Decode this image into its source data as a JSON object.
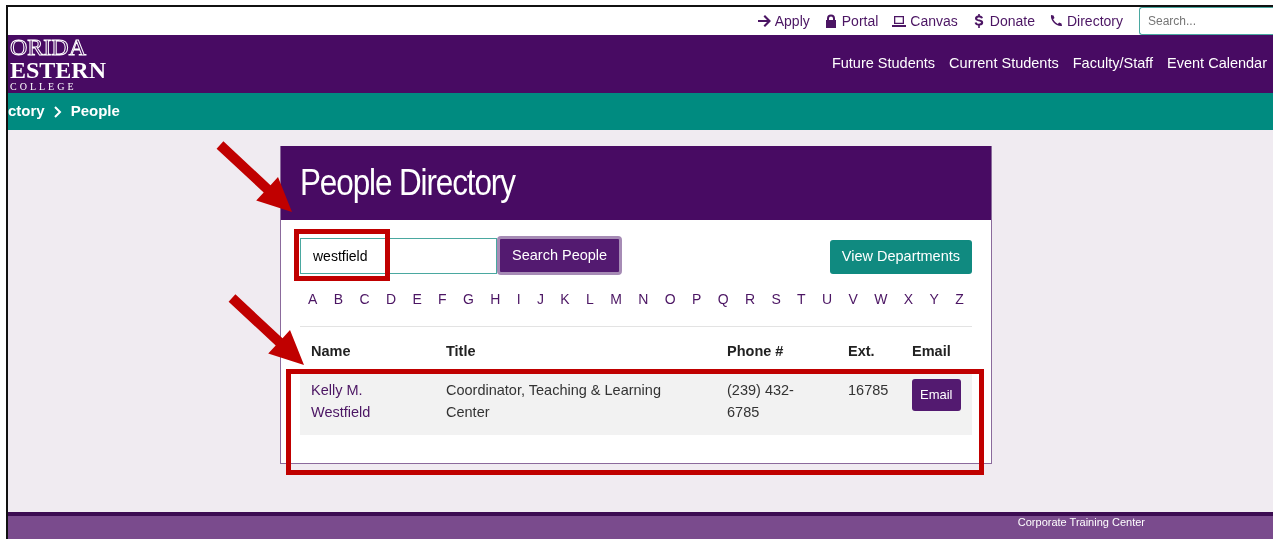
{
  "utility_links": [
    {
      "label": "Apply"
    },
    {
      "label": "Portal"
    },
    {
      "label": "Canvas"
    },
    {
      "label": "Donate"
    },
    {
      "label": "Directory"
    }
  ],
  "site_search": {
    "placeholder": "Search..."
  },
  "logo": {
    "lines": [
      "ORIDA",
      "ESTERN",
      "COLLEGE"
    ]
  },
  "main_nav": [
    "Future Students",
    "Current Students",
    "Faculty/Staff",
    "Event Calendar"
  ],
  "breadcrumb": [
    "ctory",
    "People"
  ],
  "directory": {
    "title": "People Directory",
    "search": {
      "value": "westfield",
      "button": "Search People",
      "highlighted": true
    },
    "departments_button": "View Departments",
    "letters": [
      "A",
      "B",
      "C",
      "D",
      "E",
      "F",
      "G",
      "H",
      "I",
      "J",
      "K",
      "L",
      "M",
      "N",
      "O",
      "P",
      "Q",
      "R",
      "S",
      "T",
      "U",
      "V",
      "W",
      "X",
      "Y",
      "Z"
    ],
    "table": {
      "columns": [
        "Name",
        "Title",
        "Phone #",
        "Ext.",
        "Email"
      ],
      "highlighted": true,
      "rows": [
        {
          "name": "Kelly M. Westfield",
          "title": "Coordinator, Teaching & Learning Center",
          "phone": "(239) 432-6785",
          "ext": "16785",
          "email": "Email"
        }
      ]
    }
  },
  "annotations": [
    {
      "kind": "arrow"
    },
    {
      "kind": "arrow"
    }
  ],
  "footer": {
    "text": "Corporate Training Center"
  }
}
